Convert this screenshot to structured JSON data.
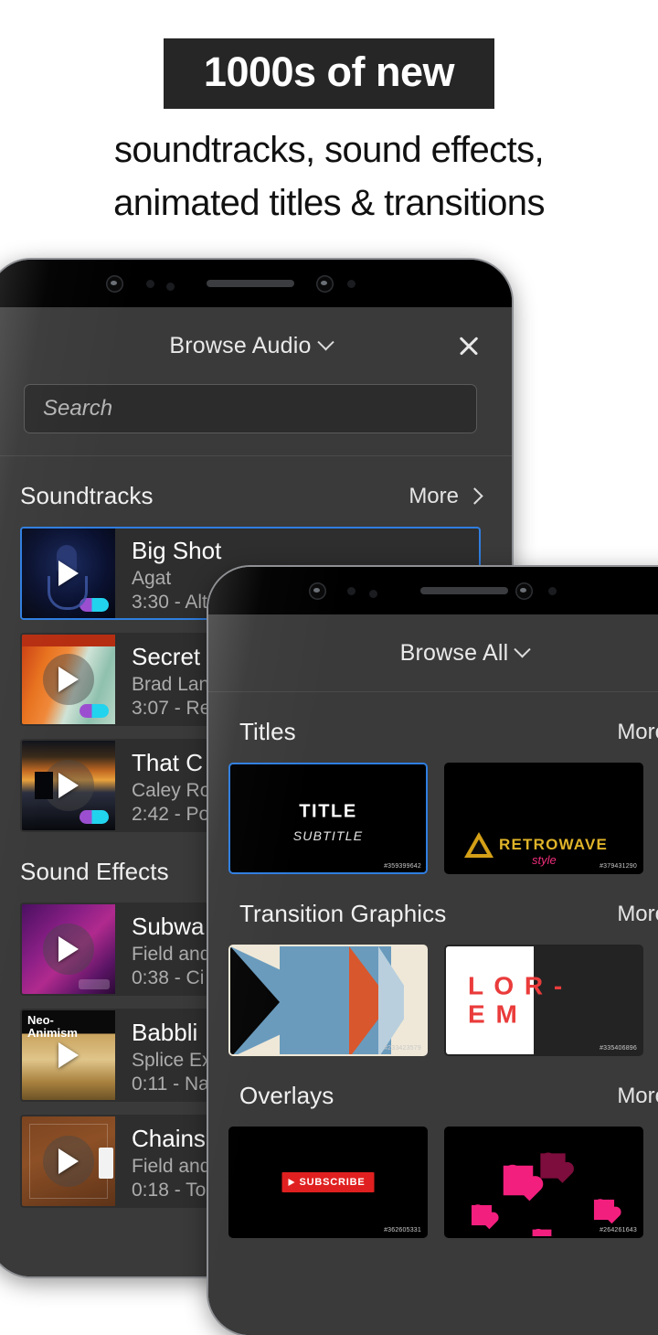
{
  "promo": {
    "badge": "1000s of new",
    "subtitle_line1": "soundtracks, sound effects,",
    "subtitle_line2": "animated titles & transitions",
    "badge_bg": "#262626",
    "badge_color": "#ffffff"
  },
  "phone_audio": {
    "header": {
      "title": "Browse Audio",
      "chevron_icon": "chevron-down-icon",
      "close_icon": "close-icon"
    },
    "search": {
      "value": "",
      "placeholder": "Search"
    },
    "sections": [
      {
        "title": "Soundtracks",
        "more_label": "More",
        "items": [
          {
            "name": "Big Shot",
            "artist": "Agat",
            "duration": "3:30",
            "meta": "3:30 - Alt",
            "selected": true,
            "premium": true,
            "art": "art-bigshot",
            "art_label": ""
          },
          {
            "name": "Secret",
            "artist": "Brad Lan",
            "duration": "3:07",
            "meta": "3:07 - Re",
            "selected": false,
            "premium": true,
            "art": "art-secret",
            "art_label": ""
          },
          {
            "name": "That C",
            "artist": "Caley Ro",
            "duration": "2:42",
            "meta": "2:42 - Po",
            "selected": false,
            "premium": true,
            "art": "art-that",
            "art_label": ""
          }
        ]
      },
      {
        "title": "Sound Effects",
        "more_label": "",
        "items": [
          {
            "name": "Subwa",
            "artist": "Field and",
            "duration": "0:38",
            "meta": "0:38 - Ci",
            "selected": false,
            "premium": false,
            "art": "art-subway",
            "art_label": ""
          },
          {
            "name": "Babbli",
            "artist": "Splice Ex",
            "duration": "0:11",
            "meta": "0:11 - Na",
            "selected": false,
            "premium": false,
            "art": "art-babbl",
            "art_label": "Neo-\nAnimism"
          },
          {
            "name": "Chains",
            "artist": "Field and",
            "duration": "0:18",
            "meta": "0:18 - To",
            "selected": false,
            "premium": false,
            "art": "art-chains",
            "art_label": ""
          }
        ]
      }
    ]
  },
  "phone_assets": {
    "header": {
      "title": "Browse All",
      "chevron_icon": "chevron-down-icon",
      "close_icon": "close-icon"
    },
    "sections": [
      {
        "title": "Titles",
        "more_label": "More",
        "cards": [
          {
            "kind": "title-card",
            "title_text": "TITLE",
            "subtitle_text": "SUBTITLE",
            "asset_id": "#359399642",
            "selected": true
          },
          {
            "kind": "retrowave",
            "brand_text": "RETROWAVE",
            "script_text": "style",
            "asset_id": "#379431290",
            "selected": false
          },
          {
            "kind": "partial-black",
            "asset_id": "",
            "selected": false
          }
        ]
      },
      {
        "title": "Transition Graphics",
        "more_label": "More",
        "cards": [
          {
            "kind": "chevron-transition",
            "asset_id": "#233423579",
            "selected": false
          },
          {
            "kind": "lorem-transition",
            "text_line1": "L O R -",
            "text_line2": "E M",
            "asset_id": "#335406896",
            "selected": false
          },
          {
            "kind": "partial-red",
            "asset_id": "",
            "selected": false
          }
        ]
      },
      {
        "title": "Overlays",
        "more_label": "More",
        "cards": [
          {
            "kind": "subscribe-overlay",
            "button_text": "SUBSCRIBE",
            "asset_id": "#362605331",
            "selected": false
          },
          {
            "kind": "hearts-overlay",
            "asset_id": "#264261643",
            "selected": false
          },
          {
            "kind": "partial-white",
            "asset_id": "",
            "selected": false
          }
        ]
      }
    ]
  },
  "colors": {
    "accent_blue": "#2f7ee0",
    "screen_bg": "#3a3a3a",
    "row_bg": "#2e2e2e",
    "text_primary": "#ffffff",
    "text_secondary": "#adadad"
  }
}
